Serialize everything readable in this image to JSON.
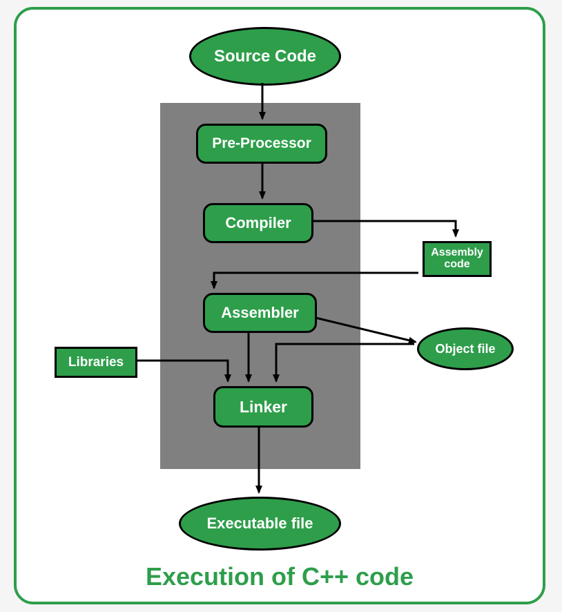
{
  "title": "Execution of C++ code",
  "nodes": {
    "source": "Source Code",
    "preprocessor": "Pre-Processor",
    "compiler": "Compiler",
    "assembly": "Assembly code",
    "assembler": "Assembler",
    "libraries": "Libraries",
    "object": "Object file",
    "linker": "Linker",
    "executable": "Executable file"
  },
  "edges": [
    {
      "from": "source",
      "to": "preprocessor"
    },
    {
      "from": "preprocessor",
      "to": "compiler"
    },
    {
      "from": "compiler",
      "to": "assembly"
    },
    {
      "from": "assembly",
      "to": "assembler"
    },
    {
      "from": "assembler",
      "to": "object"
    },
    {
      "from": "assembler",
      "to": "linker"
    },
    {
      "from": "libraries",
      "to": "linker"
    },
    {
      "from": "object",
      "to": "linker"
    },
    {
      "from": "linker",
      "to": "executable"
    }
  ]
}
